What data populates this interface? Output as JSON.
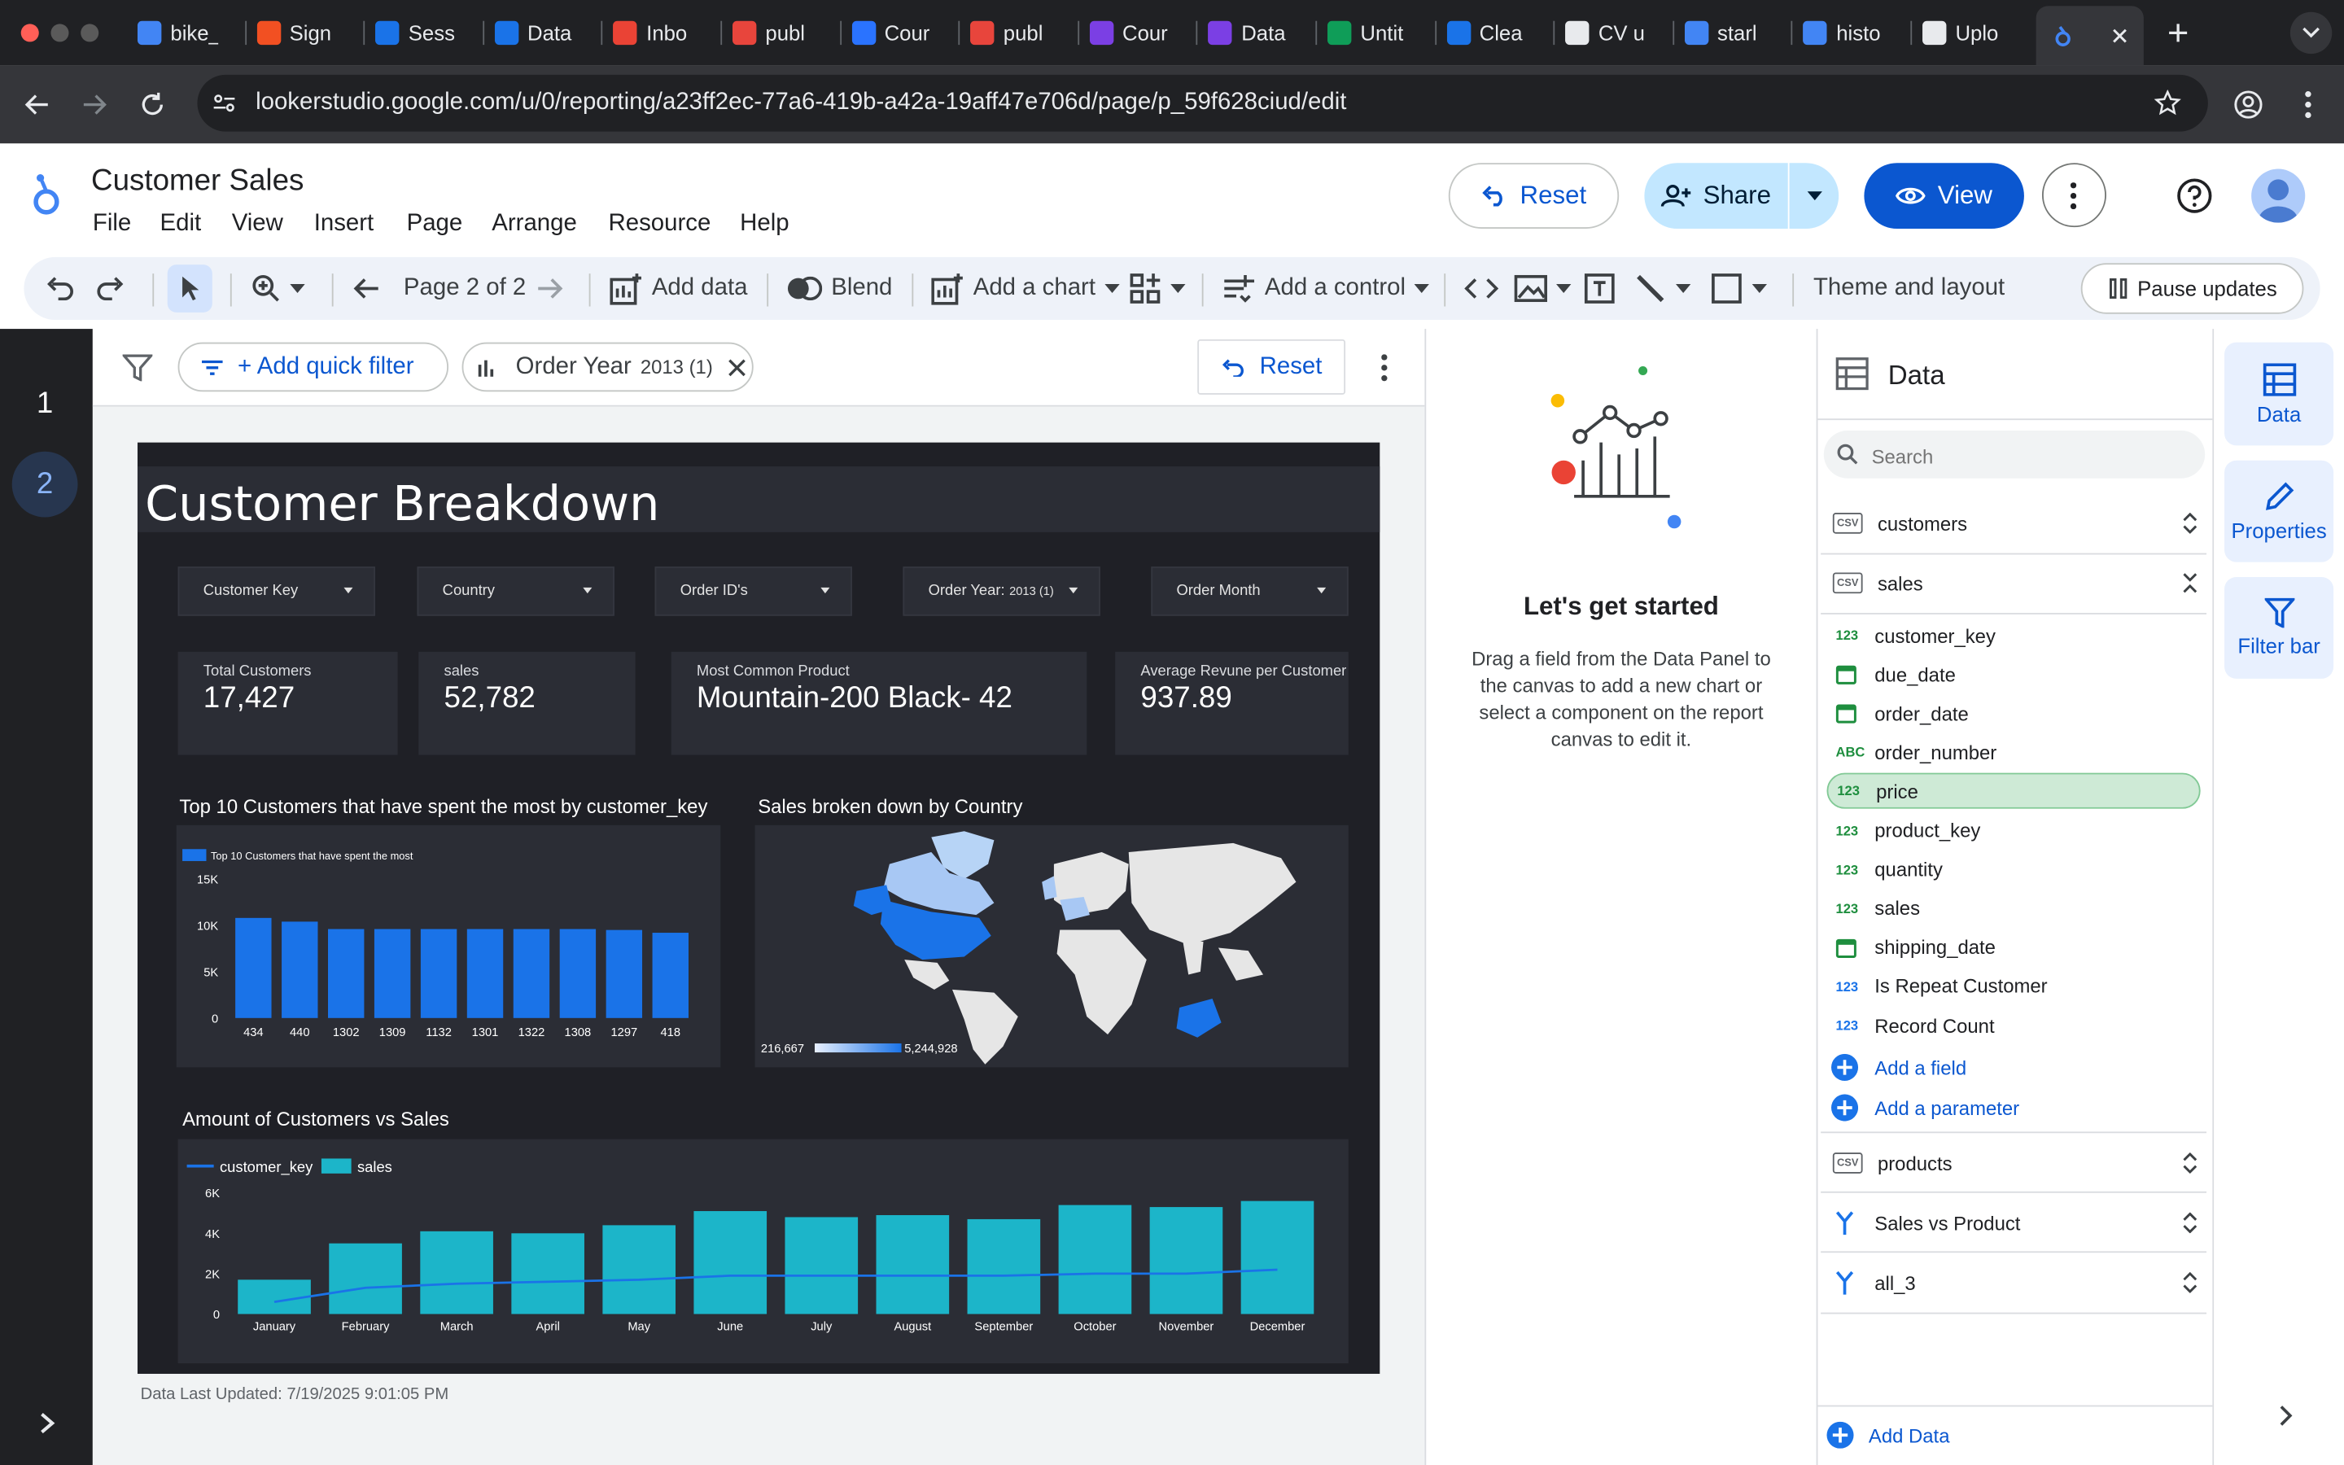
{
  "browser": {
    "tabs": [
      {
        "title": "bike_",
        "color": "#4285f4"
      },
      {
        "title": "Sign",
        "color": "#f25022"
      },
      {
        "title": "Sess",
        "color": "#1a73e8"
      },
      {
        "title": "Data",
        "color": "#1a73e8"
      },
      {
        "title": "Inbo",
        "color": "#ea4335"
      },
      {
        "title": "publ",
        "color": "#e8453c"
      },
      {
        "title": "Cour",
        "color": "#2a73ff"
      },
      {
        "title": "publ",
        "color": "#e8453c"
      },
      {
        "title": "Cour",
        "color": "#7b3fe4"
      },
      {
        "title": "Data",
        "color": "#7b3fe4"
      },
      {
        "title": "Untit",
        "color": "#0f9d58"
      },
      {
        "title": "Clea",
        "color": "#1a73e8"
      },
      {
        "title": "CV u",
        "color": "#e8eaed"
      },
      {
        "title": "starl",
        "color": "#4285f4"
      },
      {
        "title": "histo",
        "color": "#4285f4"
      },
      {
        "title": "Uplo",
        "color": "#e8eaed"
      }
    ],
    "url": "lookerstudio.google.com/u/0/reporting/a23ff2ec-77a6-419b-a42a-19aff47e706d/page/p_59f628ciud/edit"
  },
  "app": {
    "title": "Customer Sales",
    "menu": [
      "File",
      "Edit",
      "View",
      "Insert",
      "Page",
      "Arrange",
      "Resource",
      "Help"
    ],
    "reset_label": "Reset",
    "share_label": "Share",
    "view_label": "View"
  },
  "toolbar": {
    "page_indicator": "Page 2 of 2",
    "add_data": "Add data",
    "blend": "Blend",
    "add_chart": "Add a chart",
    "add_control": "Add a control",
    "theme_layout": "Theme and layout",
    "pause_updates": "Pause updates"
  },
  "pages": [
    "1",
    "2"
  ],
  "filterbar": {
    "add_quick_filter": "+ Add quick filter",
    "chip_label": "Order Year",
    "chip_value": "2013 (1)",
    "reset_label": "Reset"
  },
  "report": {
    "title": "Customer Breakdown",
    "controls": [
      {
        "label": "Customer Key",
        "value": ""
      },
      {
        "label": "Country",
        "value": ""
      },
      {
        "label": "Order ID's",
        "value": ""
      },
      {
        "label": "Order Year:",
        "value": "2013  (1)"
      },
      {
        "label": "Order Month",
        "value": ""
      }
    ],
    "scorecards": [
      {
        "label": "Total Customers",
        "value": "17,427"
      },
      {
        "label": "sales",
        "value": "52,782"
      },
      {
        "label": "Most Common Product",
        "value": "Mountain-200 Black- 42"
      },
      {
        "label": "Average Revune per Customer",
        "value": "937.89"
      }
    ],
    "chart1_title": "Top 10 Customers that have spent the most by customer_key",
    "chart2_title": "Sales broken down by Country",
    "chart3_title": "Amount of Customers vs Sales",
    "map_min": "216,667",
    "map_max": "5,244,928",
    "last_updated": "Data Last Updated: 7/19/2025 9:01:05 PM"
  },
  "chart_data": [
    {
      "type": "bar",
      "title": "Top 10 Customers that have spent the most by customer_key",
      "legend": "Top 10 Customers that have spent the most",
      "categories": [
        "434",
        "440",
        "1302",
        "1309",
        "1132",
        "1301",
        "1322",
        "1308",
        "1297",
        "418"
      ],
      "values": [
        10800,
        10400,
        9600,
        9600,
        9600,
        9600,
        9600,
        9600,
        9500,
        9200
      ],
      "yticks": [
        "0",
        "5K",
        "10K",
        "15K"
      ],
      "ylim": [
        0,
        15000
      ],
      "color": "#1a73e8"
    },
    {
      "type": "bar",
      "title": "Amount of Customers vs Sales",
      "categories": [
        "January",
        "February",
        "March",
        "April",
        "May",
        "June",
        "July",
        "August",
        "September",
        "October",
        "November",
        "December"
      ],
      "series": [
        {
          "name": "sales",
          "type": "bar",
          "color": "#1cb5c9",
          "values": [
            1700,
            3500,
            4100,
            4000,
            4400,
            5100,
            4800,
            4900,
            4700,
            5400,
            5300,
            5600
          ]
        },
        {
          "name": "customer_key",
          "type": "line",
          "color": "#1a73e8",
          "values": [
            600,
            1300,
            1500,
            1600,
            1700,
            1900,
            1900,
            1900,
            1900,
            2000,
            2000,
            2200
          ]
        }
      ],
      "yticks": [
        "0",
        "2K",
        "4K",
        "6K"
      ],
      "ylim": [
        0,
        6000
      ]
    }
  ],
  "start_panel": {
    "heading": "Let's get started",
    "body": "Drag a field from the Data Panel to the canvas to add a new chart or select a component on the report canvas to edit it."
  },
  "data_panel": {
    "title": "Data",
    "search_placeholder": "Search",
    "sources": [
      {
        "name": "customers",
        "icon": "CSV"
      },
      {
        "name": "sales",
        "icon": "CSV"
      }
    ],
    "fields": [
      {
        "type": "123",
        "name": "customer_key",
        "color": "#1e8e3e"
      },
      {
        "type": "cal",
        "name": "due_date",
        "color": "#1e8e3e"
      },
      {
        "type": "cal",
        "name": "order_date",
        "color": "#1e8e3e"
      },
      {
        "type": "ABC",
        "name": "order_number",
        "color": "#1e8e3e"
      },
      {
        "type": "123",
        "name": "price",
        "color": "#1e8e3e",
        "selected": true
      },
      {
        "type": "123",
        "name": "product_key",
        "color": "#1e8e3e"
      },
      {
        "type": "123",
        "name": "quantity",
        "color": "#1e8e3e"
      },
      {
        "type": "123",
        "name": "sales",
        "color": "#1e8e3e"
      },
      {
        "type": "cal",
        "name": "shipping_date",
        "color": "#1e8e3e"
      },
      {
        "type": "123",
        "name": "Is Repeat Customer",
        "color": "#1a73e8"
      },
      {
        "type": "123",
        "name": "Record Count",
        "color": "#1a73e8"
      }
    ],
    "add_field": "Add a field",
    "add_parameter": "Add a parameter",
    "more_sources": [
      {
        "name": "products",
        "icon": "CSV"
      },
      {
        "name": "Sales vs Product",
        "icon": "blend"
      },
      {
        "name": "all_3",
        "icon": "blend"
      }
    ],
    "add_data": "Add Data"
  },
  "side_rail": [
    "Data",
    "Properties",
    "Filter bar"
  ],
  "colors": {
    "accent": "#0b57d0",
    "share_bg": "#c2e7ff",
    "report_bg": "#1f2026",
    "bar_blue": "#1a73e8",
    "bar_teal": "#1cb5c9"
  }
}
